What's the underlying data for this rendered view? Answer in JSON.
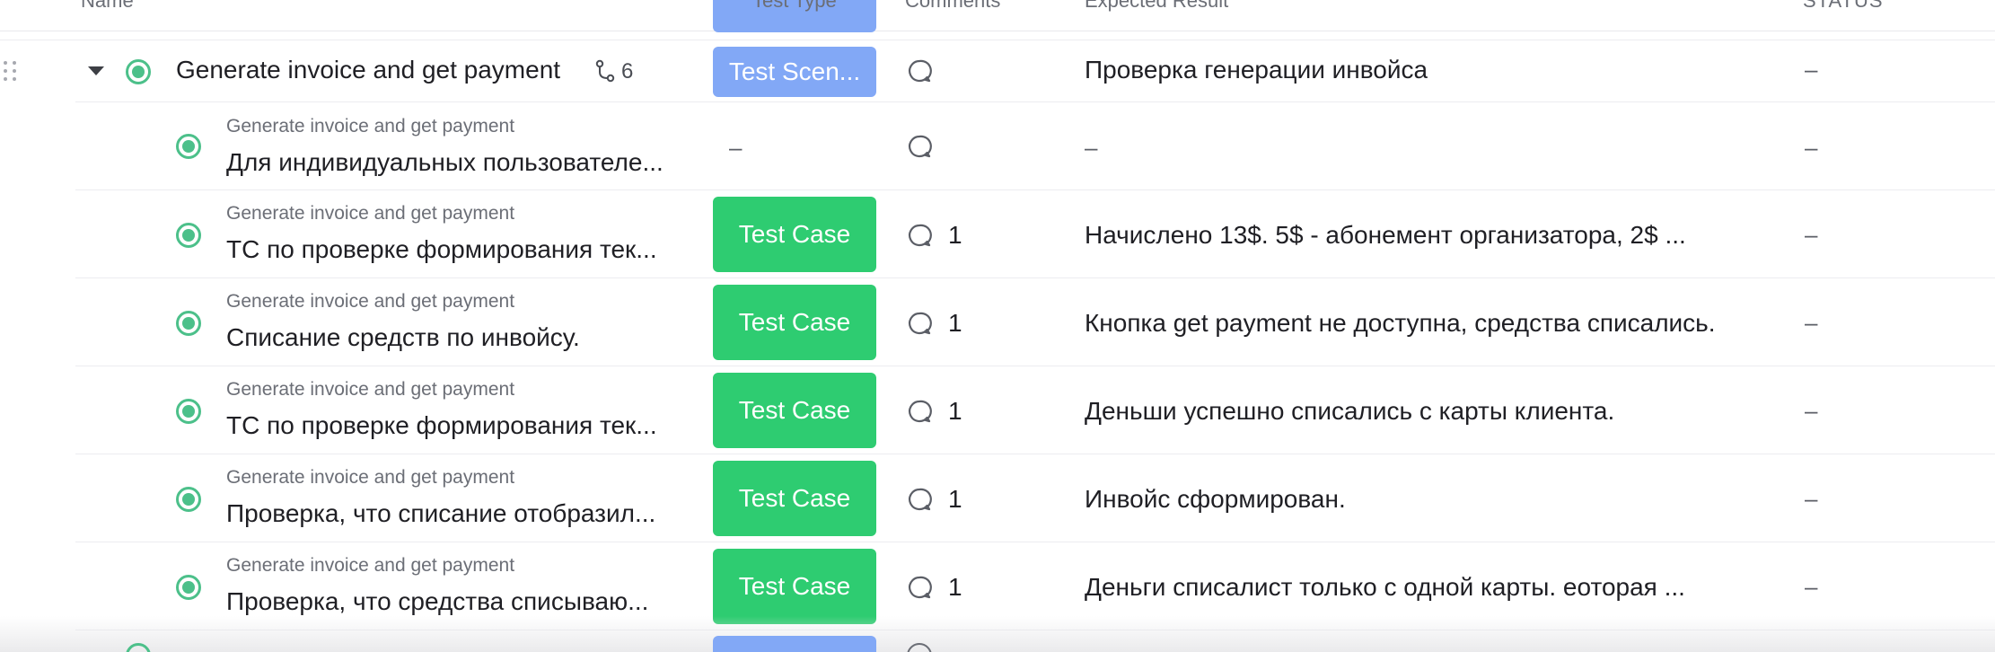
{
  "columns": {
    "name": "Name",
    "test_type": "Test Type",
    "comments": "Comments",
    "expected_result": "Expected Result",
    "status": "STATUS"
  },
  "parent": {
    "title": "Generate invoice and get payment",
    "subtask_count": "6",
    "test_type": "Test Scen...",
    "expected": "Проверка генерации инвойса",
    "status": "–"
  },
  "rows": [
    {
      "parent_label": "Generate invoice and get payment",
      "title": "Для индивидуальных пользователе...",
      "test_type": "–",
      "comment_count": "",
      "expected": "–",
      "status": "–"
    },
    {
      "parent_label": "Generate invoice and get payment",
      "title": "ТС по проверке формирования тек...",
      "test_type": "Test Case",
      "comment_count": "1",
      "expected": "Начислено 13$. 5$ - абонемент организатора, 2$ ...",
      "status": "–"
    },
    {
      "parent_label": "Generate invoice and get payment",
      "title": "Списание средств по инвойсу.",
      "test_type": "Test Case",
      "comment_count": "1",
      "expected": "Кнопка get payment не доступна, средства списались.",
      "status": "–"
    },
    {
      "parent_label": "Generate invoice and get payment",
      "title": "ТС по проверке формирования тек...",
      "test_type": "Test Case",
      "comment_count": "1",
      "expected": "Деньши успешно списались с карты клиента.",
      "status": "–"
    },
    {
      "parent_label": "Generate invoice and get payment",
      "title": "Проверка, что списание отобразил...",
      "test_type": "Test Case",
      "comment_count": "1",
      "expected": "Инвойс сформирован.",
      "status": "–"
    },
    {
      "parent_label": "Generate invoice and get payment",
      "title": "Проверка, что средства списываю...",
      "test_type": "Test Case",
      "comment_count": "1",
      "expected": "Деньги списалист только с одной карты. еоторая ...",
      "status": "–"
    }
  ],
  "colors": {
    "scenario_pill": "#82a8f6",
    "case_pill": "#2ecc71",
    "status_dot": "#4cc08a"
  },
  "icons": {
    "drag": "drag-handle-icon",
    "expand": "caret-down-icon",
    "status": "status-circle-icon",
    "subtasks": "subtask-icon",
    "comment": "comment-bubble-icon"
  }
}
